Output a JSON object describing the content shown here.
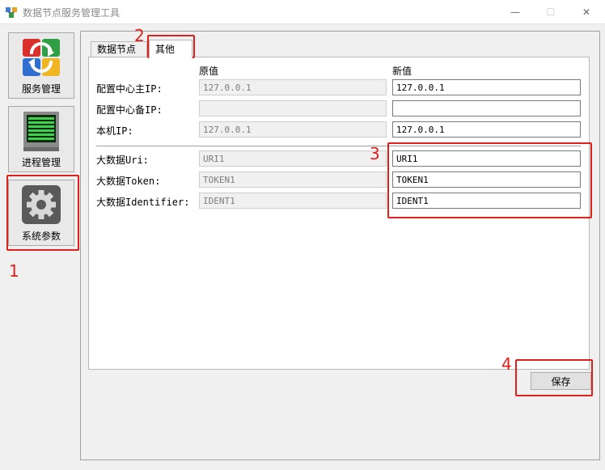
{
  "window": {
    "title": "数据节点服务管理工具",
    "minimize_glyph": "—",
    "maximize_glyph": "☐",
    "close_glyph": "✕"
  },
  "sidebar": {
    "items": [
      {
        "label": "服务管理",
        "icon": "service-manage-icon"
      },
      {
        "label": "进程管理",
        "icon": "process-monitor-icon"
      },
      {
        "label": "系统参数",
        "icon": "gear-icon"
      }
    ]
  },
  "tabs": [
    {
      "label": "数据节点",
      "active": false
    },
    {
      "label": "其他",
      "active": true
    }
  ],
  "form": {
    "header_original": "原值",
    "header_new": "新值",
    "rows": [
      {
        "label": "配置中心主IP:",
        "original": "127.0.0.1",
        "new": "127.0.0.1"
      },
      {
        "label": "配置中心备IP:",
        "original": "",
        "new": ""
      },
      {
        "label": "本机IP:",
        "original": "127.0.0.1",
        "new": "127.0.0.1"
      },
      {
        "label": "大数据Uri:",
        "original": "URI1",
        "new": "URI1"
      },
      {
        "label": "大数据Token:",
        "original": "TOKEN1",
        "new": "TOKEN1"
      },
      {
        "label": "大数据Identifier:",
        "original": "IDENT1",
        "new": "IDENT1"
      }
    ]
  },
  "save_label": "保存",
  "annotations": [
    "1",
    "2",
    "3",
    "4"
  ],
  "colors": {
    "annotation_red": "#e0201a",
    "panel_bg": "#f0f0f0"
  }
}
